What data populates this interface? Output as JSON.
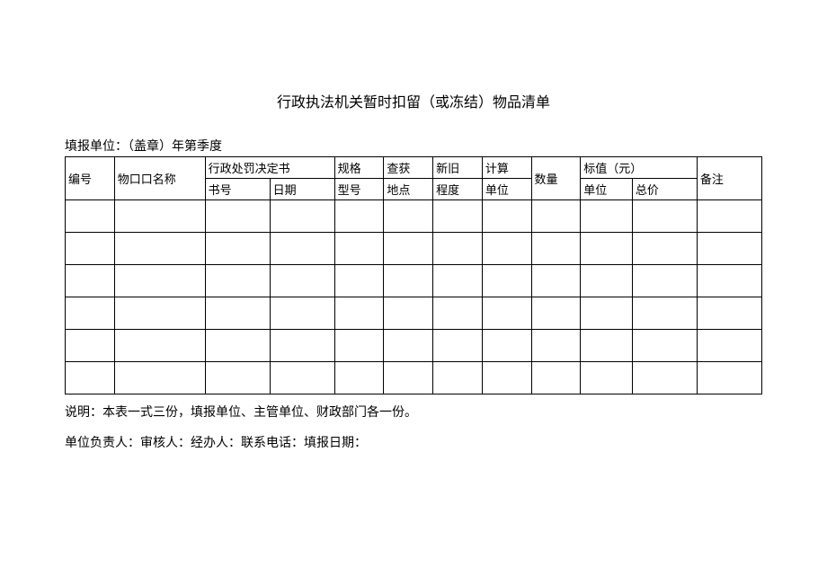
{
  "title": "行政执法机关暂时扣留（或冻结）物品清单",
  "preline": "填报单位：（盖章）年第季度",
  "headers": {
    "num": "编号",
    "name": "物口口名称",
    "book_group": "行政处罚决定书",
    "spec": "规格",
    "loc": "查获",
    "cond": "新旧",
    "calc_unit": "计算",
    "qty": "数量",
    "value_group": "标值（元）",
    "note": "备注",
    "book_no": "书号",
    "date": "日期",
    "model": "型号",
    "place": "地点",
    "degree": "程度",
    "unit2": "单位",
    "vunit": "单位",
    "total": "总价"
  },
  "note_desc": "说明：本表一式三份，填报单位、主管单位、财政部门各一份。",
  "footer": "单位负责人：审核人：经办人：联系电话：填报日期："
}
